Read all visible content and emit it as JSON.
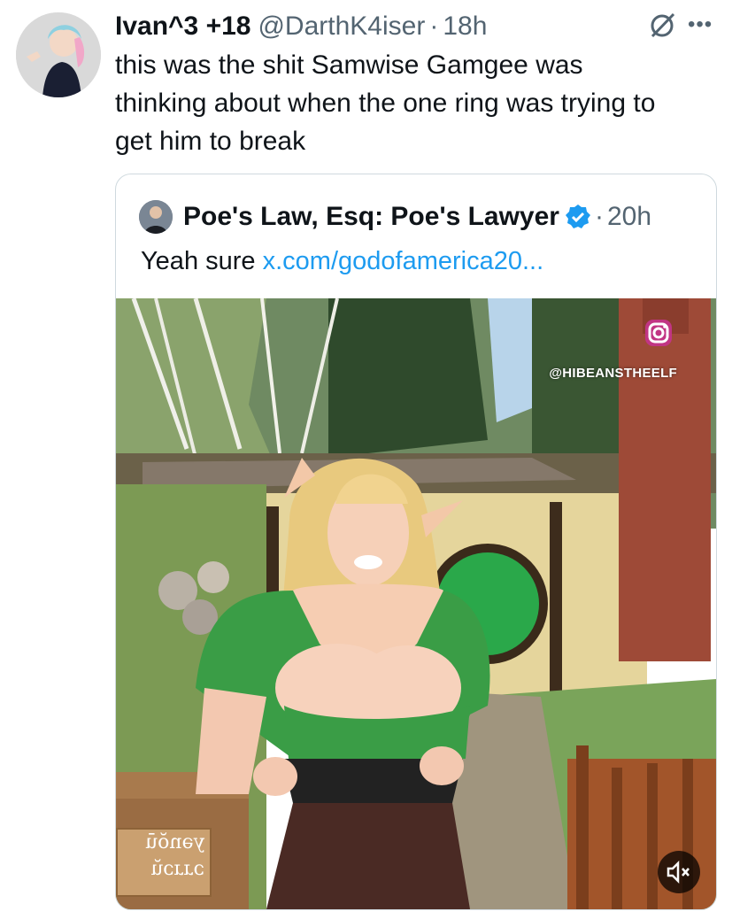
{
  "tweet": {
    "display_name": "Ivan^3 +18",
    "handle": "@DarthK4iser",
    "separator": "·",
    "time": "18h",
    "text": "this was the shit Samwise Gamgee was\nthinking about when the one ring was trying to\nget him to break",
    "icons": {
      "mute": "mute-icon",
      "more": "more-icon"
    }
  },
  "quote": {
    "display_name": "Poe's Law, Esq: Poe's Lawyer",
    "verified": true,
    "separator": "·",
    "time": "20h",
    "text_prefix": "Yeah sure",
    "link": "x.com/godofamerica20...",
    "media": {
      "watermark": "@HIBEANSTHEELF",
      "sign_line1": "yənŏū",
      "sign_line2": "ɔɹɹɔŭ",
      "sound_icon": "muted-speaker-icon",
      "instagram_icon": "instagram-icon"
    }
  },
  "colors": {
    "link": "#1d9bf0",
    "verified": "#1d9bf0",
    "secondary_text": "#536471"
  }
}
